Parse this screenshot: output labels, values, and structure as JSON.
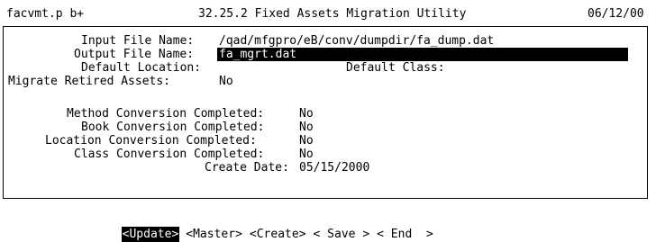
{
  "header": {
    "program": "facvmt.p b+",
    "title": "32.25.2 Fixed Assets Migration Utility",
    "date": "06/12/00"
  },
  "form": {
    "input_file_label": "Input File Name:",
    "input_file_value": "/qad/mfgpro/eB/conv/dumpdir/fa_dump.dat",
    "output_file_label": "Output File Name:",
    "output_file_value": "fa_mgrt.dat",
    "default_location_label": "Default Location:",
    "default_location_value": "",
    "default_class_label": "Default Class:",
    "default_class_value": "",
    "migrate_retired_label": "Migrate Retired Assets:",
    "migrate_retired_value": "No",
    "method_conv_label": "Method Conversion Completed:",
    "method_conv_value": "No",
    "book_conv_label": "Book Conversion Completed:",
    "book_conv_value": "No",
    "location_conv_label": "Location Conversion Completed:",
    "location_conv_value": "No",
    "class_conv_label": "Class Conversion Completed:",
    "class_conv_value": "No",
    "create_date_label": "Create Date:",
    "create_date_value": "05/15/2000"
  },
  "actions": {
    "update": "<Update>",
    "master": "<Master>",
    "create": "<Create>",
    "save": "< Save >",
    "end": "< End  >"
  }
}
